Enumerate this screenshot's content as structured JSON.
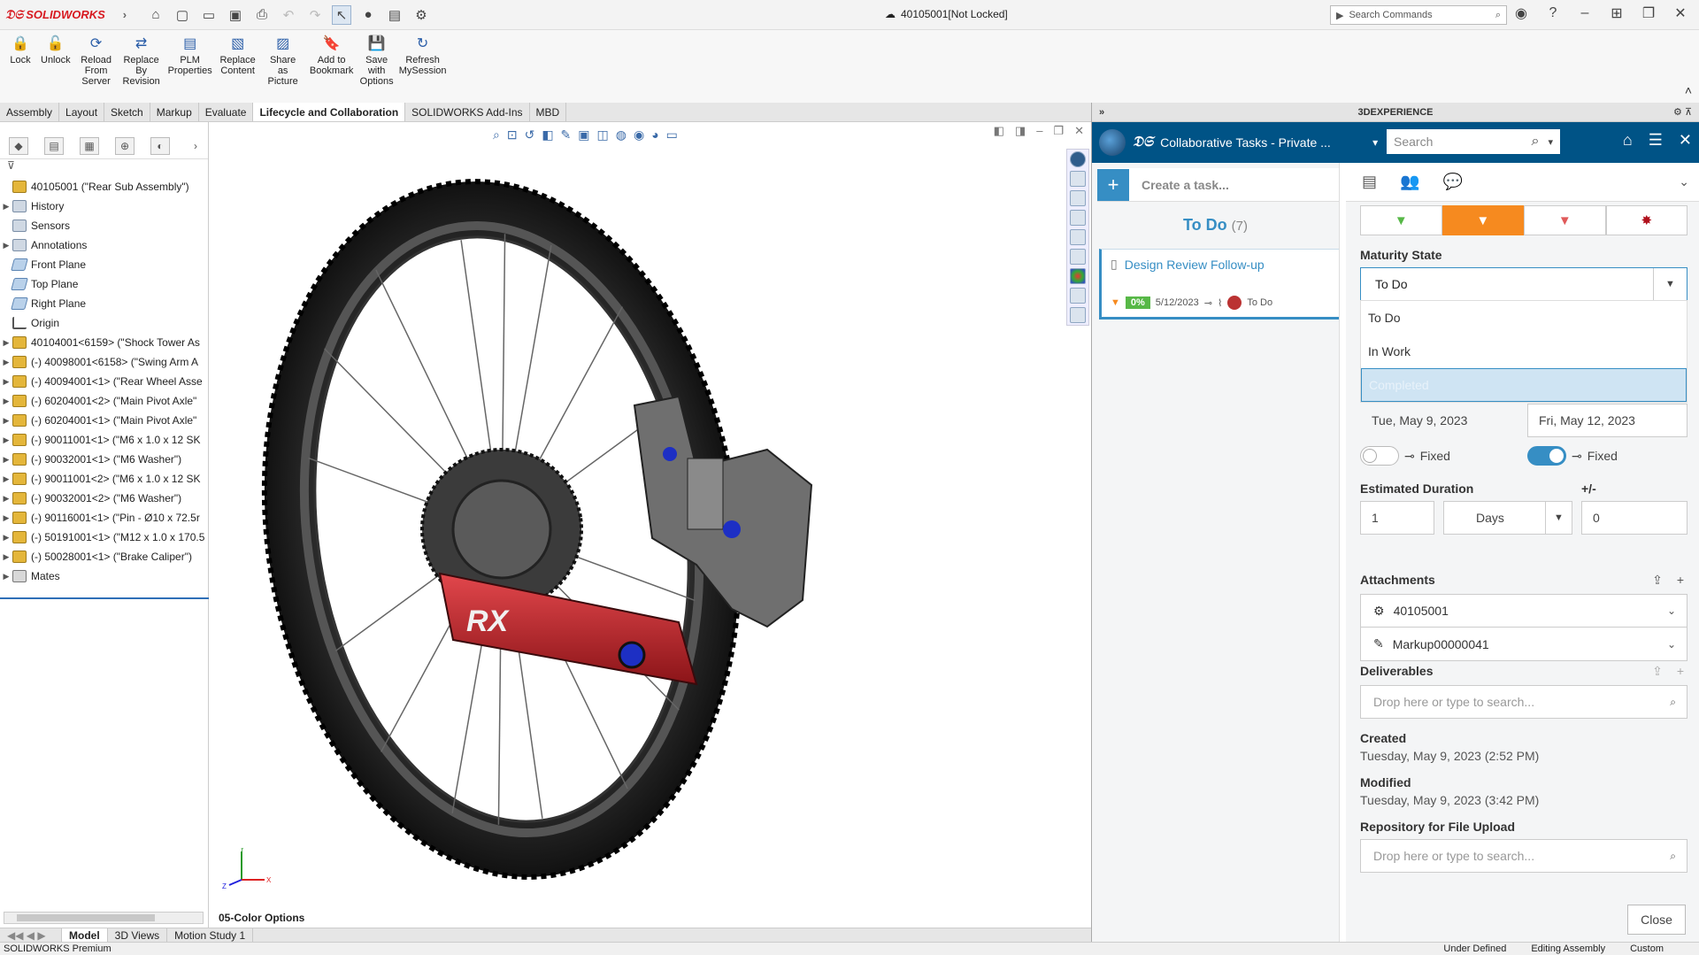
{
  "app": {
    "brand": "SOLIDWORKS",
    "doc_title": "40105001[Not Locked]",
    "search_placeholder": "Search Commands"
  },
  "ribbon": {
    "buttons": [
      "Lock",
      "Unlock",
      "Reload From Server",
      "Replace By Revision",
      "PLM Properties",
      "Replace Content",
      "Share as Picture",
      "Add to Bookmark",
      "Save with Options",
      "Refresh MySession"
    ]
  },
  "tabs": [
    "Assembly",
    "Layout",
    "Sketch",
    "Markup",
    "Evaluate",
    "Lifecycle and Collaboration",
    "SOLIDWORKS Add-Ins",
    "MBD"
  ],
  "tree": {
    "root": "40105001 (\"Rear Sub Assembly\")",
    "items": [
      {
        "label": "History",
        "icon": "folder",
        "exp": true
      },
      {
        "label": "Sensors",
        "icon": "folder",
        "exp": false
      },
      {
        "label": "Annotations",
        "icon": "folder",
        "exp": true
      },
      {
        "label": "Front Plane",
        "icon": "plane",
        "exp": false
      },
      {
        "label": "Top Plane",
        "icon": "plane",
        "exp": false
      },
      {
        "label": "Right Plane",
        "icon": "plane",
        "exp": false
      },
      {
        "label": "Origin",
        "icon": "origin",
        "exp": false
      },
      {
        "label": "40104001<6159> (\"Shock Tower As",
        "icon": "asm",
        "exp": true
      },
      {
        "label": "(-) 40098001<6158> (\"Swing Arm A",
        "icon": "asm",
        "exp": true
      },
      {
        "label": "(-) 40094001<1> (\"Rear Wheel Asse",
        "icon": "asm",
        "exp": true
      },
      {
        "label": "(-) 60204001<2> (\"Main Pivot Axle\"",
        "icon": "asm",
        "exp": true
      },
      {
        "label": "(-) 60204001<1> (\"Main Pivot Axle\"",
        "icon": "asm",
        "exp": true
      },
      {
        "label": "(-) 90011001<1> (\"M6 x 1.0 x 12 SK",
        "icon": "asm",
        "exp": true
      },
      {
        "label": "(-) 90032001<1> (\"M6 Washer\")",
        "icon": "asm",
        "exp": true
      },
      {
        "label": "(-) 90011001<2> (\"M6 x 1.0 x 12 SK",
        "icon": "asm",
        "exp": true
      },
      {
        "label": "(-) 90032001<2> (\"M6 Washer\")",
        "icon": "asm",
        "exp": true
      },
      {
        "label": "(-) 90116001<1> (\"Pin - Ø10 x 72.5r",
        "icon": "asm",
        "exp": true
      },
      {
        "label": "(-) 50191001<1> (\"M12 x 1.0 x 170.5",
        "icon": "asm",
        "exp": true
      },
      {
        "label": "(-) 50028001<1> (\"Brake Caliper\")",
        "icon": "asm",
        "exp": true
      },
      {
        "label": "Mates",
        "icon": "mates",
        "exp": true
      }
    ]
  },
  "graphics": {
    "config_label": "05-Color Options",
    "logo_text": "RX"
  },
  "bottom_tabs": [
    "Model",
    "3D Views",
    "Motion Study 1"
  ],
  "status": {
    "product": "SOLIDWORKS Premium",
    "state": "Under Defined",
    "mode": "Editing Assembly",
    "units": "Custom"
  },
  "panel": {
    "header": "3DEXPERIENCE",
    "app_title": "Collaborative Tasks - Private ...",
    "search_placeholder": "Search",
    "create_placeholder": "Create a task...",
    "column_title": "To Do",
    "column_count": "(7)",
    "task": {
      "title": "Design Review Follow-up",
      "progress": "0%",
      "date": "5/12/2023",
      "state": "To Do"
    },
    "maturity_label": "Maturity State",
    "maturity_value": "To Do",
    "maturity_options": [
      "To Do",
      "In Work",
      "Completed"
    ],
    "planned_start": "Tue, May 9, 2023",
    "planned_end": "Fri, May 12, 2023",
    "fixed_label": "Fixed",
    "est_duration_label": "Estimated Duration",
    "est_duration_value": "1",
    "duration_unit": "Days",
    "plusminus_label": "+/-",
    "plusminus_value": "0",
    "attachments_label": "Attachments",
    "attachments": [
      "40105001",
      "Markup00000041"
    ],
    "deliverables_label": "Deliverables",
    "drop_placeholder": "Drop here or type to search...",
    "created_label": "Created",
    "created_value": "Tuesday, May 9, 2023 (2:52 PM)",
    "modified_label": "Modified",
    "modified_value": "Tuesday, May 9, 2023 (3:42 PM)",
    "repo_label": "Repository for File Upload",
    "close_label": "Close",
    "accent": "#368ec4",
    "brand_bar": "#005386",
    "priority_medium": "#f68a1f"
  }
}
